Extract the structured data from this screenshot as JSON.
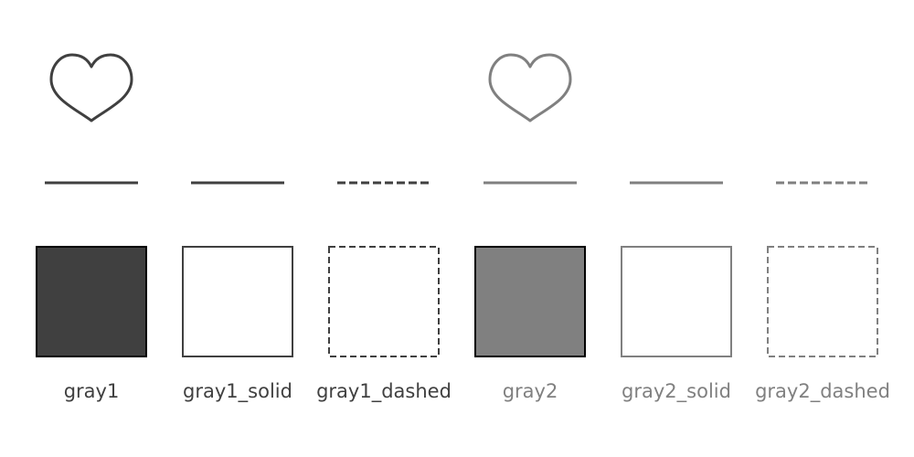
{
  "colors": {
    "gray1": "#404040",
    "gray2": "#808080",
    "swatch_border": "#000000",
    "background": "#ffffff"
  },
  "swatches": [
    {
      "label": "gray1",
      "color_key": "gray1",
      "heart": true,
      "line_style": "solid",
      "fill": true
    },
    {
      "label": "gray1_solid",
      "color_key": "gray1",
      "heart": false,
      "line_style": "solid",
      "fill": false
    },
    {
      "label": "gray1_dashed",
      "color_key": "gray1",
      "heart": false,
      "line_style": "dashed",
      "fill": false
    },
    {
      "label": "gray2",
      "color_key": "gray2",
      "heart": true,
      "line_style": "solid",
      "fill": true
    },
    {
      "label": "gray2_solid",
      "color_key": "gray2",
      "heart": false,
      "line_style": "solid",
      "fill": false
    },
    {
      "label": "gray2_dashed",
      "color_key": "gray2",
      "heart": false,
      "line_style": "dashed",
      "fill": false
    }
  ]
}
